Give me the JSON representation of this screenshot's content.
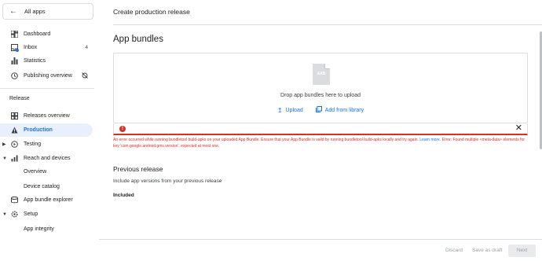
{
  "sidebar": {
    "all_apps": "All apps",
    "items": [
      {
        "label": "Dashboard",
        "icon": "dashboard-icon"
      },
      {
        "label": "Inbox",
        "icon": "inbox-icon",
        "count": "4"
      },
      {
        "label": "Statistics",
        "icon": "statistics-icon"
      },
      {
        "label": "Publishing overview",
        "icon": "publishing-icon"
      }
    ],
    "release_section": "Release",
    "release_items": [
      {
        "label": "Releases overview",
        "icon": "releases-overview-icon"
      },
      {
        "label": "Production",
        "icon": "production-icon",
        "active": true
      },
      {
        "label": "Testing",
        "icon": "testing-icon"
      },
      {
        "label": "Reach and devices",
        "icon": "reach-devices-icon"
      },
      {
        "label": "Overview"
      },
      {
        "label": "Device catalog"
      },
      {
        "label": "App bundle explorer",
        "icon": "bundle-explorer-icon"
      },
      {
        "label": "Setup",
        "icon": "setup-icon"
      },
      {
        "label": "App integrity"
      }
    ]
  },
  "main": {
    "page_title": "Create production release",
    "app_bundles_heading": "App bundles",
    "dropzone": {
      "file_label": "AAB",
      "text": "Drop app bundles here to upload",
      "upload": "Upload",
      "add_from_library": "Add from library"
    },
    "error": {
      "message": "An error occurred while running bundletool build-apks on your uploaded App Bundle. Ensure that your App Bundle is valid by running bundletool build-apks locally and try again.",
      "link": "Learn more.",
      "detail": "Error: Found multiple <meta-data> elements for key 'com.google.android.gms.version', expected at most one."
    },
    "previous_release": {
      "heading": "Previous release",
      "subtitle": "Include app versions from your previous release",
      "included": "Included"
    }
  },
  "footer": {
    "discard": "Discard",
    "save_draft": "Save as draft",
    "next": "Next"
  },
  "colors": {
    "accent": "#1a73e8",
    "error": "#d93025",
    "active_bg": "#e8f0fe"
  }
}
